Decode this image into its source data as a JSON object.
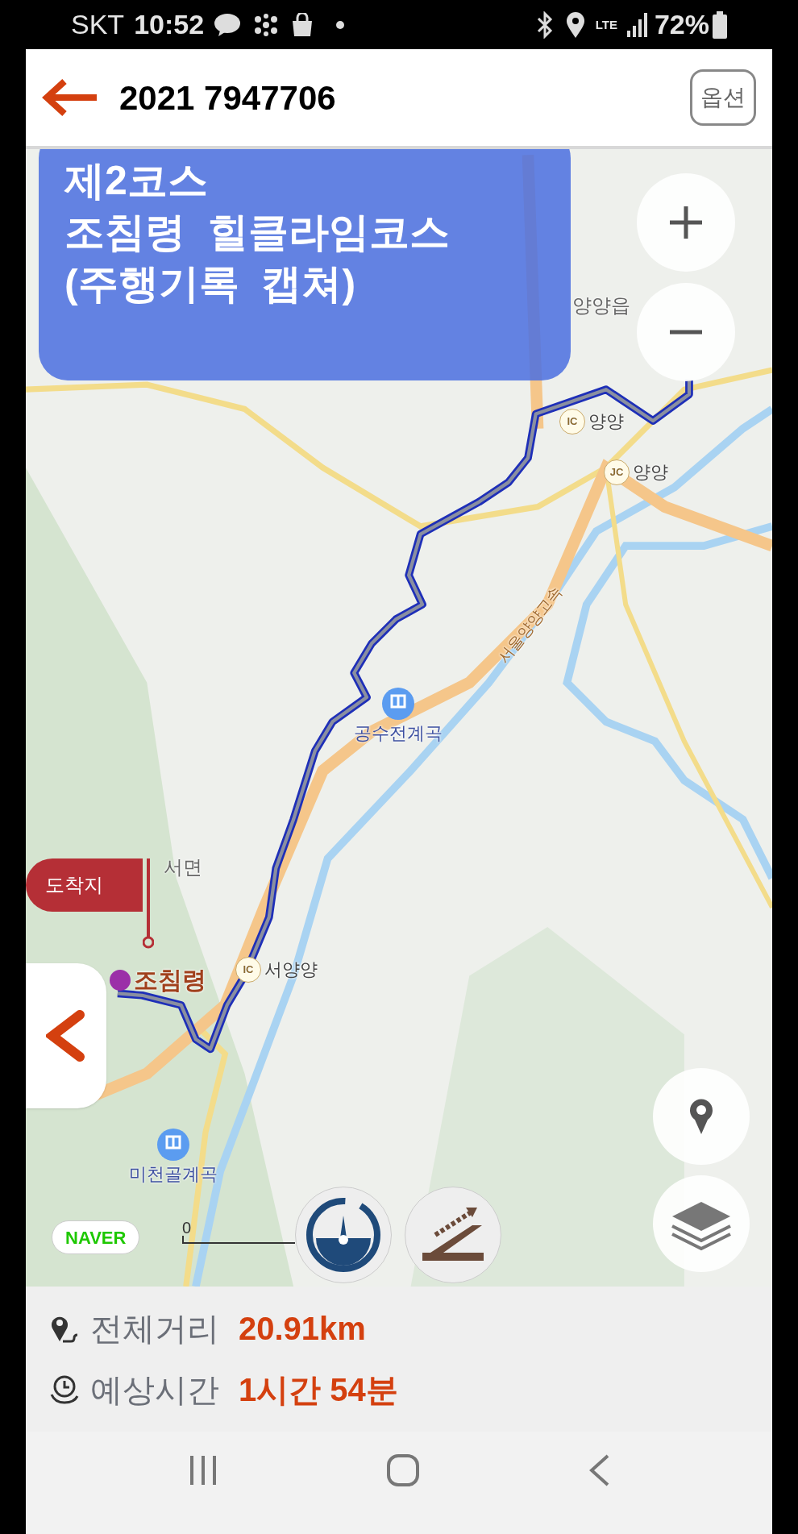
{
  "status_bar": {
    "carrier": "SKT",
    "time": "10:52",
    "network": "LTE",
    "battery": "72%"
  },
  "header": {
    "title": "2021 7947706",
    "options_button": "옵션"
  },
  "overlay": {
    "lines": [
      "제2코스",
      "조침령  힐클라임코스",
      "(주행기록  캡쳐)"
    ]
  },
  "map": {
    "labels": [
      {
        "kind": "town",
        "text": "양양읍"
      },
      {
        "kind": "ic",
        "badge": "IC",
        "text": "양양"
      },
      {
        "kind": "ic",
        "badge": "JC",
        "text": "양양"
      },
      {
        "kind": "valley",
        "text": "공수전계곡"
      },
      {
        "kind": "town",
        "text": "서면"
      },
      {
        "kind": "pass",
        "text": "조침령"
      },
      {
        "kind": "ic",
        "badge": "IC",
        "text": "서양양"
      },
      {
        "kind": "valley",
        "text": "미천골계곡"
      },
      {
        "kind": "highway",
        "text": "서울양양고속"
      }
    ],
    "destination_flag": "도착지",
    "scale_label": "0",
    "logo": "NAVER"
  },
  "summary": [
    {
      "kind": "distance",
      "label": "전체거리",
      "value": "20.91km"
    },
    {
      "kind": "time",
      "label": "예상시간",
      "value": "1시간 54분"
    }
  ]
}
